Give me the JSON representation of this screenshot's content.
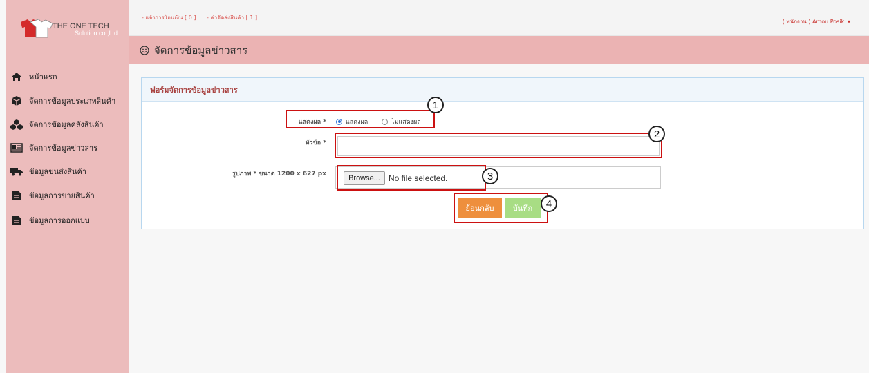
{
  "sidebar": {
    "logo": {
      "brand": "THE ONE TECH",
      "sub": "Solution co.,Ltd"
    },
    "items": [
      {
        "label": "หน้าแรก",
        "icon": "home-icon"
      },
      {
        "label": "จัดการข้อมูลประเภทสินค้า",
        "icon": "cube-icon"
      },
      {
        "label": "จัดการข้อมูลคลังสินค้า",
        "icon": "cubes-icon"
      },
      {
        "label": "จัดการข้อมูลข่าวสาร",
        "icon": "newspaper-icon"
      },
      {
        "label": "ข้อมูลขนส่งสินค้า",
        "icon": "truck-icon"
      },
      {
        "label": "ข้อมูลการขายสินค้า",
        "icon": "file-icon"
      },
      {
        "label": "ข้อมูลการออกแบบ",
        "icon": "file-icon"
      }
    ]
  },
  "topbar": {
    "link_transfer": "- แจ้งการโอนเงิน [ 0 ]",
    "link_shipping": "- ค่าจัดส่งสินค้า [ 1 ]",
    "user_menu": "( พนักงาน ) Amou Posiki ▾"
  },
  "page": {
    "title": "จัดการข้อมูลข่าวสาร"
  },
  "form": {
    "panel_title": "ฟอร์มจัดการข้อมูลข่าวสาร",
    "display_label": "แสดงผล *",
    "radio_show": "แสดงผล",
    "radio_hide": "ไม่แสดงผล",
    "selected": "แสดงผล",
    "subject_label": "หัวข้อ *",
    "subject_value": "",
    "image_label": "รูปภาพ * ขนาด 1200 x 627 px",
    "browse_label": "Browse...",
    "file_status": "No file selected.",
    "back_label": "ย้อนกลับ",
    "save_label": "บันทึก"
  },
  "annotations": [
    "1",
    "2",
    "3",
    "4"
  ],
  "colors": {
    "sidebar_bg": "#ecbcbc",
    "header_bg": "#ebb3b3",
    "back_button": "#ee8f3d",
    "save_button": "#a8dd84",
    "annotation_red": "#cc1111"
  }
}
